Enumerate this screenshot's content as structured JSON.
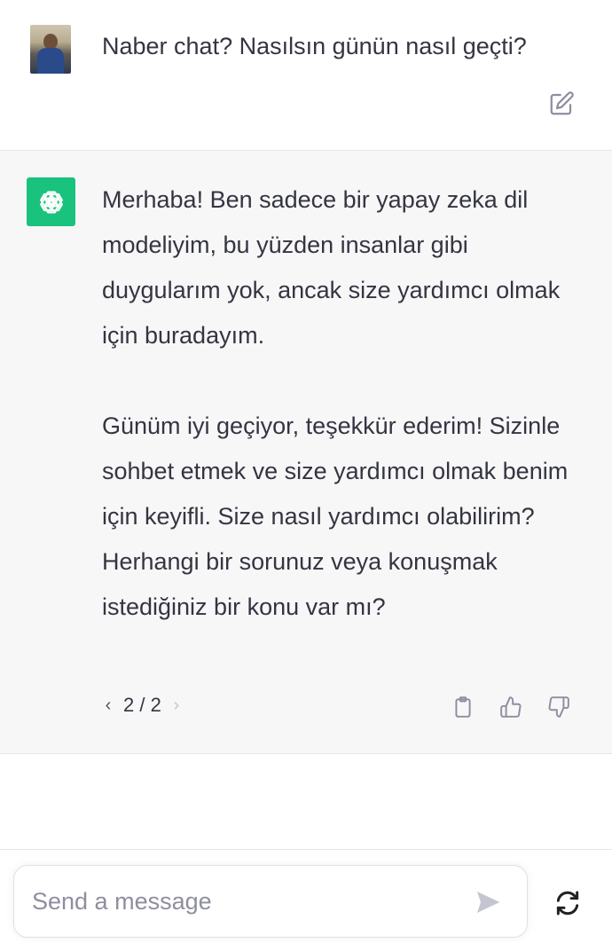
{
  "user_message": {
    "text": "Naber chat? Nasılsın günün nasıl geçti?",
    "avatar_icon": "user-photo",
    "edit_icon": "edit-icon"
  },
  "assistant_message": {
    "paragraphs": [
      "Merhaba! Ben sadece bir yapay zeka dil modeliyim, bu yüzden insanlar gibi duygularım yok, ancak size yardımcı olmak için buradayım.",
      "Günüm iyi geçiyor, teşekkür ederim! Sizinle sohbet etmek ve size yardımcı olmak benim için keyifli. Size nasıl yardımcı olabilirim? Herhangi bir sorunuz veya konuşmak istediğiniz bir konu var mı?"
    ],
    "avatar_icon": "openai-logo-icon",
    "avatar_color": "#19c37d",
    "pager": {
      "prev": "‹",
      "label": "2 / 2",
      "next": "›"
    },
    "actions": {
      "copy_icon": "clipboard-icon",
      "like_icon": "thumbs-up-icon",
      "dislike_icon": "thumbs-down-icon"
    }
  },
  "composer": {
    "placeholder": "Send a message",
    "value": "",
    "send_icon": "send-icon",
    "regenerate_icon": "regenerate-icon"
  },
  "colors": {
    "text": "#343541",
    "assistant_bg": "#f7f7f8",
    "placeholder": "#8e8ea0",
    "accent": "#19c37d"
  }
}
